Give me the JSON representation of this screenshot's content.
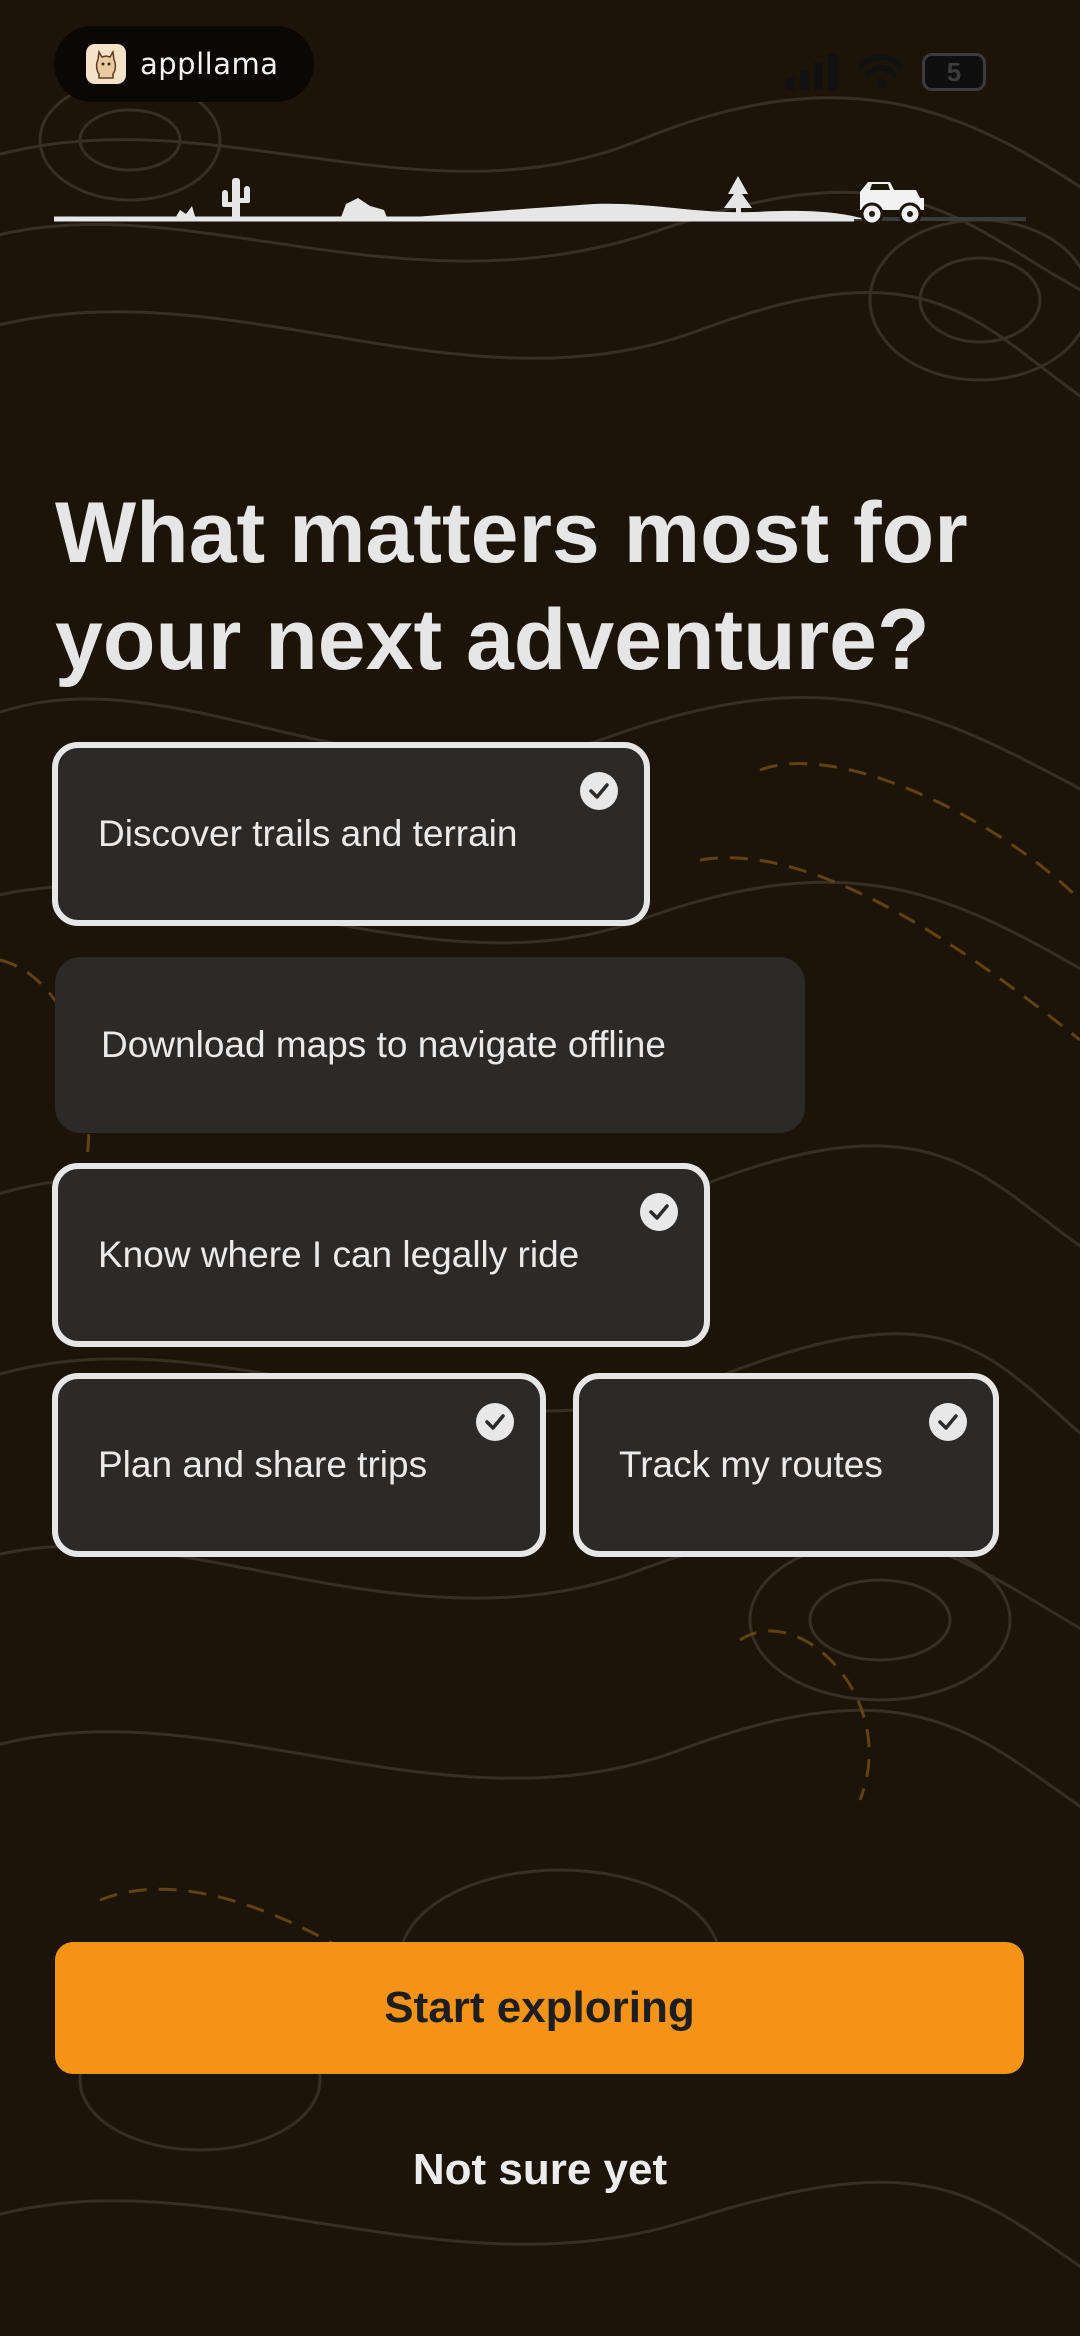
{
  "status_bar": {
    "app_name": "appllama",
    "battery": "5"
  },
  "question": "What matters most for your next adventure?",
  "options": [
    {
      "label": "Discover trails and terrain",
      "selected": true
    },
    {
      "label": "Download maps to navigate offline",
      "selected": false
    },
    {
      "label": "Know where I can legally ride",
      "selected": true
    },
    {
      "label": "Plan and share trips",
      "selected": true
    },
    {
      "label": "Track my routes",
      "selected": true
    }
  ],
  "primary_button": "Start exploring",
  "secondary_button": "Not sure yet",
  "colors": {
    "background": "#1c1409",
    "accent": "#f39419",
    "card": "#2c2a29",
    "selected_border": "#e6e6e6"
  }
}
